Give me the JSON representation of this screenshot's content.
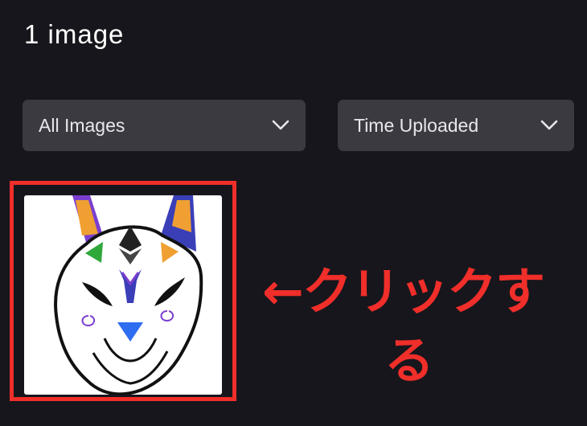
{
  "gallery": {
    "count_label": "1 image"
  },
  "filters": {
    "type_filter": {
      "selected": "All Images",
      "icon": "chevron-down-icon"
    },
    "sort_filter": {
      "selected": "Time Uploaded",
      "icon": "chevron-down-icon"
    }
  },
  "images": [
    {
      "alt": "white fox mask with ethereum logo"
    }
  ],
  "annotation": {
    "line1": "←クリックす",
    "line2": "る",
    "color": "#f02e2a"
  },
  "colors": {
    "background": "#16161c",
    "dropdown_bg": "#3a3a40",
    "highlight_border": "#f02e2a"
  }
}
